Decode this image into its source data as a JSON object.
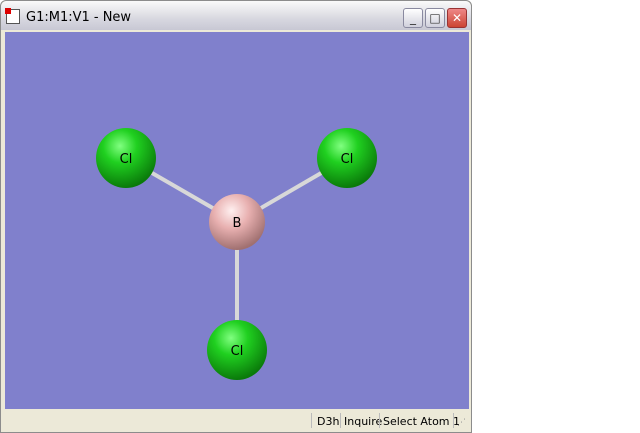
{
  "window": {
    "title": "G1:M1:V1 - New",
    "minimize": "_",
    "maximize": "□",
    "close": "✕"
  },
  "molecule": {
    "atoms": [
      {
        "label": "B",
        "element": "B",
        "color": "#e8b0b0"
      },
      {
        "label": "Cl",
        "element": "Cl",
        "color": "#20d020"
      },
      {
        "label": "Cl",
        "element": "Cl",
        "color": "#20d020"
      },
      {
        "label": "Cl",
        "element": "Cl",
        "color": "#20d020"
      }
    ]
  },
  "status": {
    "symmetry": "D3h",
    "mode": "Inquire",
    "hint": "Select Atom 1"
  },
  "colors": {
    "background": "#8080cc"
  }
}
